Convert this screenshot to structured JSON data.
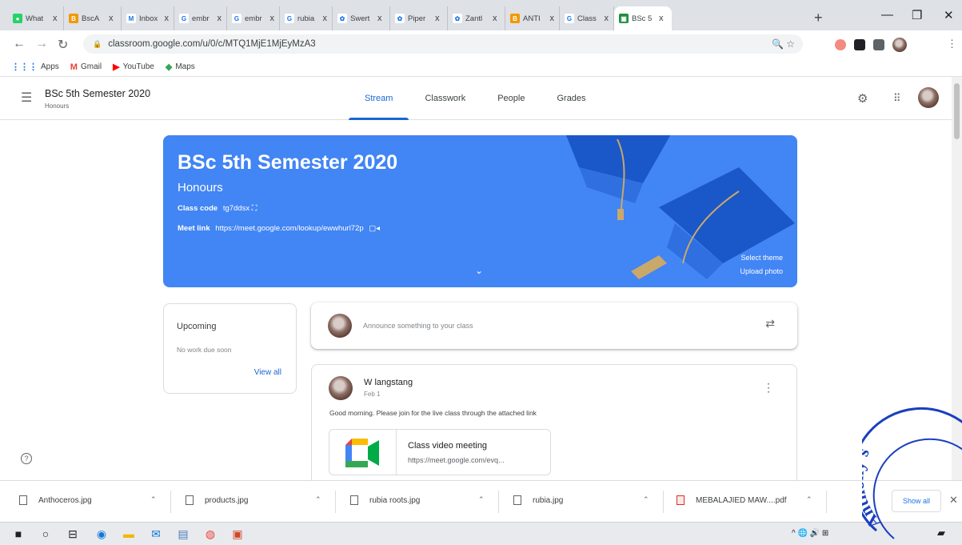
{
  "browser": {
    "tabs": [
      {
        "label": "What",
        "favicon_color": "#25d366",
        "glyph": "●"
      },
      {
        "label": "BscA",
        "favicon_color": "#f29900",
        "glyph": "B"
      },
      {
        "label": "Inbox",
        "favicon_color": "#ffffff",
        "glyph": "M"
      },
      {
        "label": "embr",
        "favicon_color": "#ffffff",
        "glyph": "G"
      },
      {
        "label": "embr",
        "favicon_color": "#ffffff",
        "glyph": "G"
      },
      {
        "label": "rubia",
        "favicon_color": "#ffffff",
        "glyph": "G"
      },
      {
        "label": "Swert",
        "favicon_color": "#ffffff",
        "glyph": "✿"
      },
      {
        "label": "Piper",
        "favicon_color": "#ffffff",
        "glyph": "✿"
      },
      {
        "label": "Zantl",
        "favicon_color": "#ffffff",
        "glyph": "✿"
      },
      {
        "label": "ANTI",
        "favicon_color": "#f29900",
        "glyph": "B"
      },
      {
        "label": "Class",
        "favicon_color": "#ffffff",
        "glyph": "G"
      },
      {
        "label": "BSc 5",
        "favicon_color": "#1e8e3e",
        "glyph": "▣"
      }
    ],
    "tab_close": "x",
    "new_tab": "+",
    "url": "classroom.google.com/u/0/c/MTQ1MjE1MjEyMzA3",
    "bookmarks": [
      {
        "label": "Apps",
        "icon": "apps-grid-icon",
        "glyph": "⋮⋮⋮",
        "color": "#1a73e8"
      },
      {
        "label": "Gmail",
        "icon": "gmail-icon",
        "glyph": "M",
        "color": "#ea4335"
      },
      {
        "label": "YouTube",
        "icon": "youtube-icon",
        "glyph": "▶",
        "color": "#ff0000"
      },
      {
        "label": "Maps",
        "icon": "maps-icon",
        "glyph": "◆",
        "color": "#34a853"
      }
    ]
  },
  "classroom": {
    "class_name": "BSc 5th Semester 2020",
    "section": "Honours",
    "nav_tabs": [
      "Stream",
      "Classwork",
      "People",
      "Grades"
    ],
    "active_tab": "Stream",
    "banner": {
      "title": "BSc 5th Semester 2020",
      "subtitle": "Honours",
      "class_code_label": "Class code",
      "class_code": "tg7ddsx",
      "meet_link_label": "Meet link",
      "meet_link": "https://meet.google.com/lookup/ewwhurl72p",
      "select_theme": "Select theme",
      "upload_photo": "Upload photo",
      "color": "#4285f4"
    },
    "upcoming": {
      "title": "Upcoming",
      "text": "No work due soon",
      "view_all": "View all"
    },
    "announce_placeholder": "Announce something to your class",
    "post": {
      "author": "W langstang",
      "date": "Feb 1",
      "body": "Good morning. Please join for the live class through the attached link",
      "attachment_title": "Class video meeting",
      "attachment_url": "https://meet.google.com/evq..."
    }
  },
  "downloads": {
    "items": [
      "Anthoceros.jpg",
      "products.jpg",
      "rubia roots.jpg",
      "rubia.jpg",
      "MEBALAJIED MAW....pdf"
    ],
    "show_all": "Show all"
  },
  "taskbar": {
    "tray_text": "^ 🌐 🔊 ⊞"
  },
  "stamp": {
    "text": "Anthony's"
  }
}
